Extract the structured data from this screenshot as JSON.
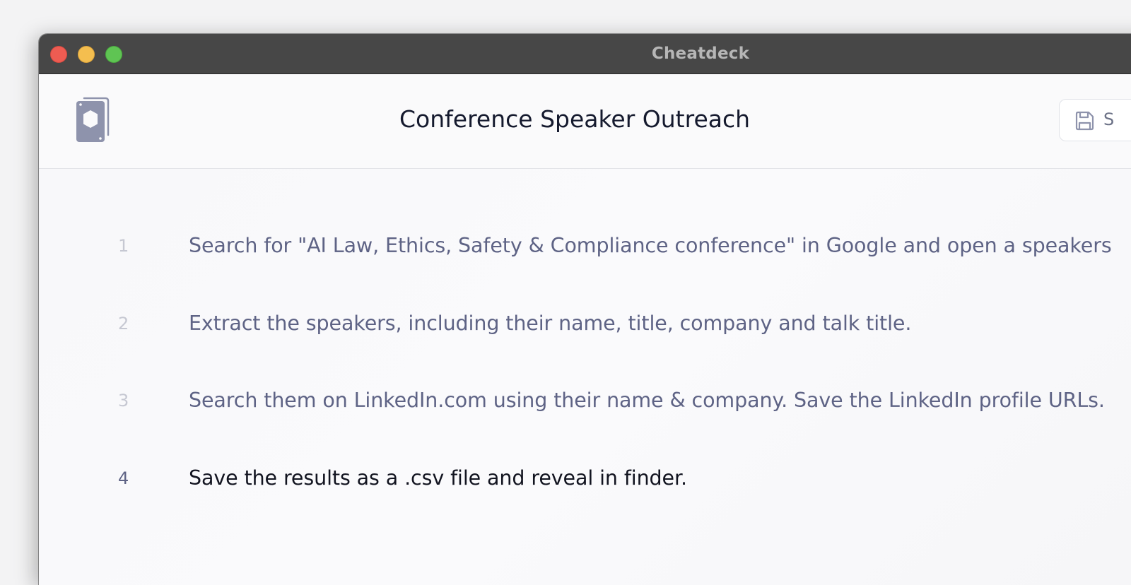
{
  "window": {
    "title": "Cheatdeck"
  },
  "header": {
    "title": "Conference Speaker Outreach",
    "logo_icon": "cheatdeck-logo-icon",
    "save_icon": "floppy-disk-icon",
    "save_label": "S"
  },
  "steps": [
    {
      "number": "1",
      "text": "Search for \"AI Law, Ethics, Safety & Compliance conference\" in Google and open a speakers"
    },
    {
      "number": "2",
      "text": "Extract the speakers, including their name, title, company and talk title."
    },
    {
      "number": "3",
      "text": "Search them on LinkedIn.com using their name & company. Save the LinkedIn profile URLs."
    },
    {
      "number": "4",
      "text": "Save the results as a .csv file and reveal in finder.",
      "active": true
    }
  ],
  "colors": {
    "titlebar": "#474747",
    "close": "#ee5c52",
    "minimize": "#f4be4f",
    "zoom": "#5fc453",
    "step_text": "#5e6385",
    "active_step_text": "#121420",
    "logo": "#8e93ac"
  }
}
